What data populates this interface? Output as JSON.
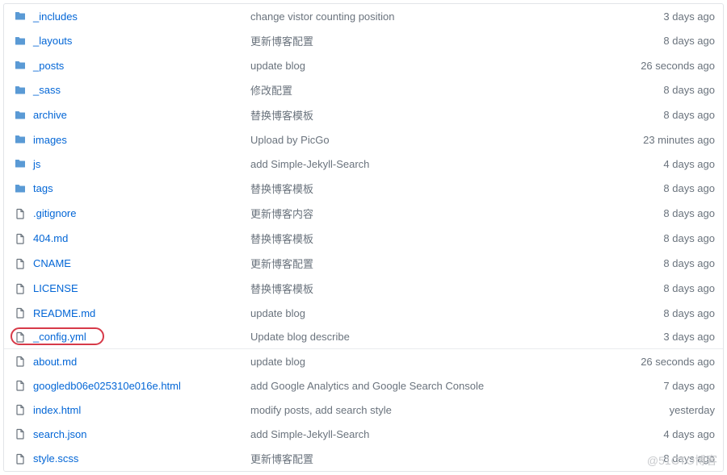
{
  "files": [
    {
      "type": "folder",
      "name": "_includes",
      "message": "change vistor counting position",
      "time": "3 days ago",
      "highlight": false
    },
    {
      "type": "folder",
      "name": "_layouts",
      "message": "更新博客配置",
      "time": "8 days ago",
      "highlight": false
    },
    {
      "type": "folder",
      "name": "_posts",
      "message": "update blog",
      "time": "26 seconds ago",
      "highlight": false
    },
    {
      "type": "folder",
      "name": "_sass",
      "message": "修改配置",
      "time": "8 days ago",
      "highlight": false
    },
    {
      "type": "folder",
      "name": "archive",
      "message": "替换博客模板",
      "time": "8 days ago",
      "highlight": false
    },
    {
      "type": "folder",
      "name": "images",
      "message": "Upload by PicGo",
      "time": "23 minutes ago",
      "highlight": false
    },
    {
      "type": "folder",
      "name": "js",
      "message": "add Simple-Jekyll-Search",
      "time": "4 days ago",
      "highlight": false
    },
    {
      "type": "folder",
      "name": "tags",
      "message": "替换博客模板",
      "time": "8 days ago",
      "highlight": false
    },
    {
      "type": "file",
      "name": ".gitignore",
      "message": "更新博客内容",
      "time": "8 days ago",
      "highlight": false
    },
    {
      "type": "file",
      "name": "404.md",
      "message": "替换博客模板",
      "time": "8 days ago",
      "highlight": false
    },
    {
      "type": "file",
      "name": "CNAME",
      "message": "更新博客配置",
      "time": "8 days ago",
      "highlight": false
    },
    {
      "type": "file",
      "name": "LICENSE",
      "message": "替换博客模板",
      "time": "8 days ago",
      "highlight": false
    },
    {
      "type": "file",
      "name": "README.md",
      "message": "update blog",
      "time": "8 days ago",
      "highlight": false
    },
    {
      "type": "file",
      "name": "_config.yml",
      "message": "Update blog describe",
      "time": "3 days ago",
      "highlight": true
    },
    {
      "type": "file",
      "name": "about.md",
      "message": "update blog",
      "time": "26 seconds ago",
      "highlight": false
    },
    {
      "type": "file",
      "name": "googledb06e025310e016e.html",
      "message": "add Google Analytics and Google Search Console",
      "time": "7 days ago",
      "highlight": false
    },
    {
      "type": "file",
      "name": "index.html",
      "message": "modify posts, add search style",
      "time": "yesterday",
      "highlight": false
    },
    {
      "type": "file",
      "name": "search.json",
      "message": "add Simple-Jekyll-Search",
      "time": "4 days ago",
      "highlight": false
    },
    {
      "type": "file",
      "name": "style.scss",
      "message": "更新博客配置",
      "time": "8 days ago",
      "highlight": false
    }
  ],
  "watermark": "@51CTO博客"
}
